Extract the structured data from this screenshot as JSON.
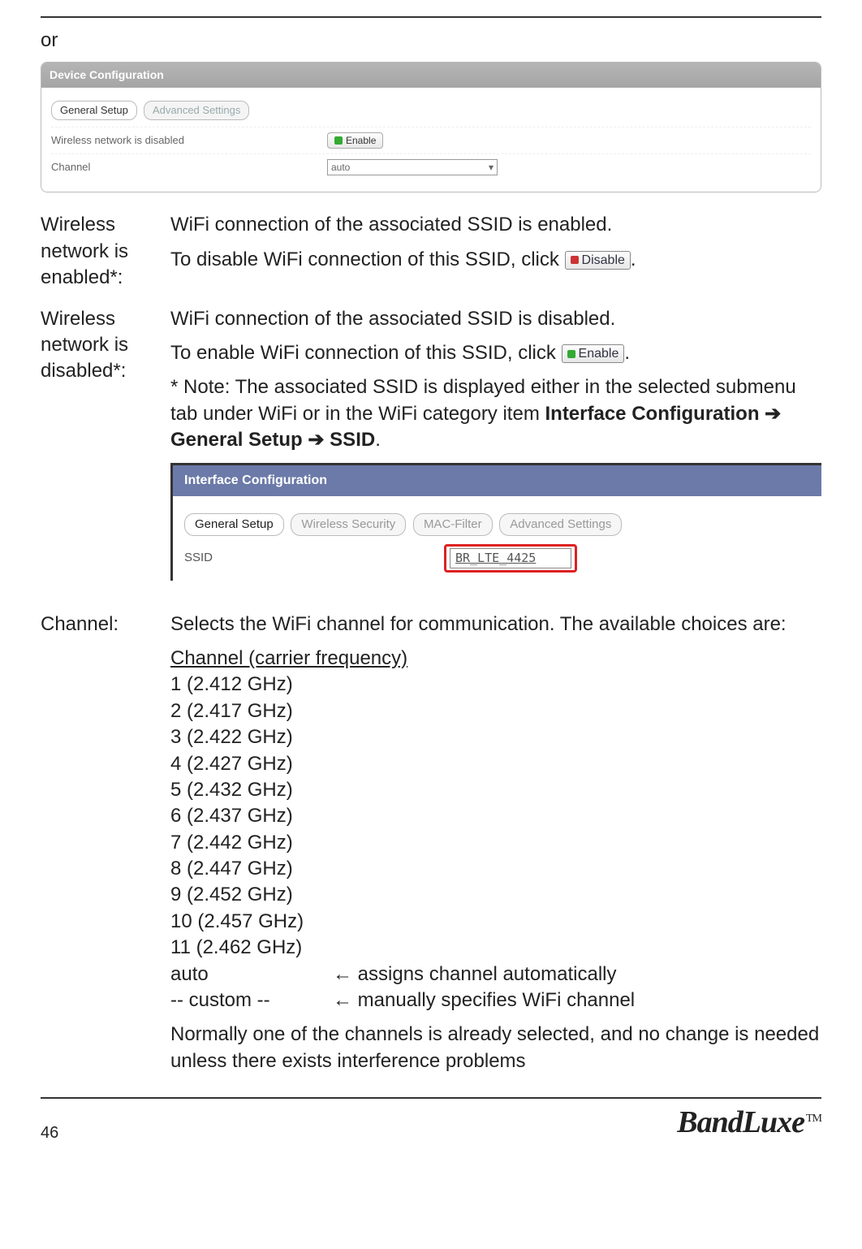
{
  "or_text": "or",
  "panel1": {
    "title": "Device Configuration",
    "tabs": {
      "active": "General Setup",
      "inactive": "Advanced Settings"
    },
    "row_disabled_label": "Wireless network is disabled",
    "enable_btn": "Enable",
    "row_channel_label": "Channel",
    "channel_value": "auto"
  },
  "def_enabled": {
    "term": "Wireless network is enabled*:",
    "line1": "WiFi connection of the associated SSID is enabled.",
    "line2a": "To disable WiFi connection of this SSID, click ",
    "disable_btn": "Disable",
    "line2b": "."
  },
  "def_disabled": {
    "term": "Wireless network is disabled*:",
    "line1": "WiFi connection of the associated SSID is disabled.",
    "line2a": "To enable WiFi connection of this SSID, click ",
    "enable_btn": "Enable",
    "line2b": ".",
    "note_a": "* Note: The associated SSID is displayed either in the selected submenu tab under WiFi or in the WiFi category item ",
    "note_b1": "Interface Configuration",
    "arrow": " ➔ ",
    "note_b2": "General Setup",
    "note_b3": "SSID",
    "note_end": "."
  },
  "panel2": {
    "title": "Interface Configuration",
    "tabs": [
      "General Setup",
      "Wireless Security",
      "MAC-Filter",
      "Advanced Settings"
    ],
    "ssid_label": "SSID",
    "ssid_value": "BR_LTE_4425"
  },
  "def_channel": {
    "term": "Channel:",
    "intro": "Selects the WiFi channel for communication. The available choices are:",
    "list_header": "Channel (carrier frequency)",
    "channels": [
      "1 (2.412 GHz)",
      "2 (2.417 GHz)",
      "3 (2.422 GHz)",
      "4 (2.427 GHz)",
      "5 (2.432 GHz)",
      "6 (2.437 GHz)",
      "7 (2.442 GHz)",
      "8 (2.447 GHz)",
      "9 (2.452 GHz)",
      "10 (2.457 GHz)",
      "11 (2.462 GHz)"
    ],
    "auto_label": "auto",
    "auto_desc": "← assigns channel automatically",
    "custom_label": "-- custom --",
    "custom_desc": "← manually specifies WiFi channel",
    "footer_note": "Normally one of the channels is already selected, and no change is needed unless there exists interference problems"
  },
  "page_number": "46",
  "brand": "BandLuxe",
  "tm": "TM"
}
